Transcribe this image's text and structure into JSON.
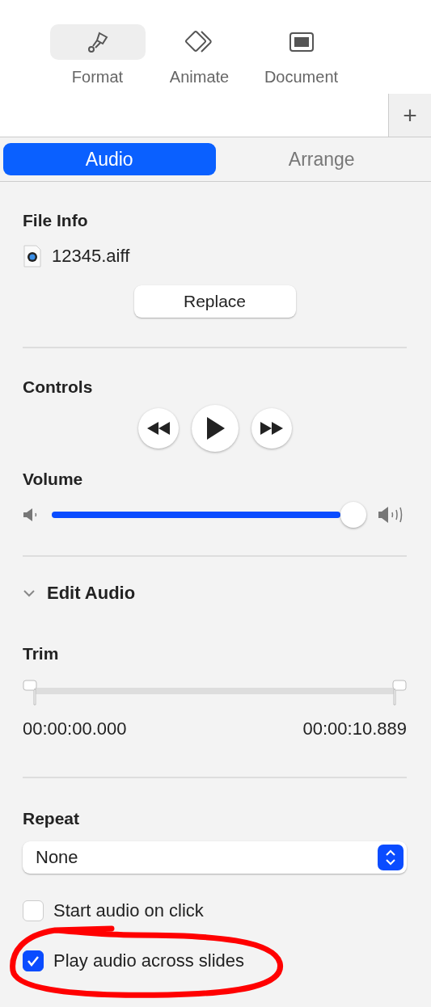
{
  "toolbar": [
    {
      "label": "Format",
      "selected": true
    },
    {
      "label": "Animate",
      "selected": false
    },
    {
      "label": "Document",
      "selected": false
    }
  ],
  "add_button": "+",
  "tabs": [
    {
      "label": "Audio",
      "selected": true
    },
    {
      "label": "Arrange",
      "selected": false
    }
  ],
  "file_info": {
    "heading": "File Info",
    "file_name": "12345.aiff",
    "replace_button": "Replace"
  },
  "controls": {
    "heading": "Controls"
  },
  "volume": {
    "heading": "Volume",
    "level": 1
  },
  "edit_audio": {
    "title": "Edit Audio",
    "expanded": true
  },
  "trim": {
    "heading": "Trim",
    "handles": [
      {
        "level": 0
      },
      {
        "level": 1
      }
    ],
    "start_time": "00:00:00.000",
    "end_time": "00:00:10.889"
  },
  "repeat": {
    "heading": "Repeat",
    "value": "None"
  },
  "options": [
    {
      "label": "Start audio on click",
      "checked": false,
      "circled": false
    },
    {
      "label": "Play audio across slides",
      "checked": true,
      "circled": true
    }
  ]
}
